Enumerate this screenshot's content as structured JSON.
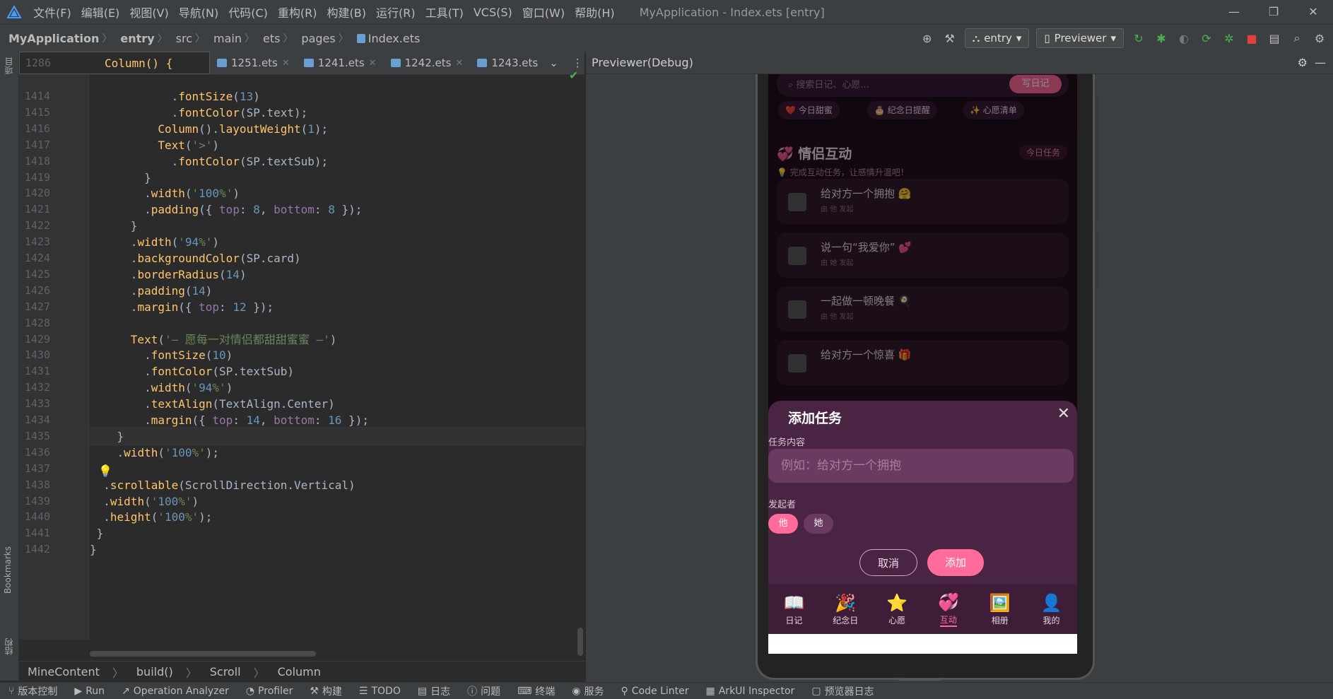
{
  "window": {
    "title": "MyApplication - Index.ets [entry]",
    "menus": [
      "文件(F)",
      "编辑(E)",
      "视图(V)",
      "导航(N)",
      "代码(C)",
      "重构(R)",
      "构建(B)",
      "运行(R)",
      "工具(T)",
      "VCS(S)",
      "窗口(W)",
      "帮助(H)"
    ],
    "controls": [
      "—",
      "❐",
      "✕"
    ]
  },
  "breadcrumb": [
    "MyApplication",
    "entry",
    "src",
    "main",
    "ets",
    "pages",
    "Index.ets"
  ],
  "toolbar": {
    "module": "entry",
    "device": "Previewer"
  },
  "left_strip": {
    "project": "项目",
    "bookmarks": "Bookmarks",
    "structure": "结构"
  },
  "editor": {
    "sticky_line_number": "1286",
    "sticky_code": "Column() {",
    "tabs": [
      "1251.ets",
      "1241.ets",
      "1242.ets",
      "1243.ets"
    ],
    "lines": [
      {
        "n": "1414",
        "code": "            .fontSize(13)"
      },
      {
        "n": "1415",
        "code": "            .fontColor(SP.text);"
      },
      {
        "n": "1416",
        "code": "          Column().layoutWeight(1);"
      },
      {
        "n": "1417",
        "code": "          Text('>')"
      },
      {
        "n": "1418",
        "code": "            .fontColor(SP.textSub);"
      },
      {
        "n": "1419",
        "code": "        }"
      },
      {
        "n": "1420",
        "code": "        .width('100%')"
      },
      {
        "n": "1421",
        "code": "        .padding({ top: 8, bottom: 8 });"
      },
      {
        "n": "1422",
        "code": "      }"
      },
      {
        "n": "1423",
        "code": "      .width('94%')"
      },
      {
        "n": "1424",
        "code": "      .backgroundColor(SP.card)"
      },
      {
        "n": "1425",
        "code": "      .borderRadius(14)"
      },
      {
        "n": "1426",
        "code": "      .padding(14)"
      },
      {
        "n": "1427",
        "code": "      .margin({ top: 12 });"
      },
      {
        "n": "1428",
        "code": ""
      },
      {
        "n": "1429",
        "code": "      Text('— 愿每一对情侣都甜甜蜜蜜 —')"
      },
      {
        "n": "1430",
        "code": "        .fontSize(10)"
      },
      {
        "n": "1431",
        "code": "        .fontColor(SP.textSub)"
      },
      {
        "n": "1432",
        "code": "        .width('94%')"
      },
      {
        "n": "1433",
        "code": "        .textAlign(TextAlign.Center)"
      },
      {
        "n": "1434",
        "code": "        .margin({ top: 14, bottom: 16 });"
      },
      {
        "n": "1435",
        "code": "    }"
      },
      {
        "n": "1436",
        "code": "    .width('100%');"
      },
      {
        "n": "1437",
        "code": "  }"
      },
      {
        "n": "1438",
        "code": "  .scrollable(ScrollDirection.Vertical)"
      },
      {
        "n": "1439",
        "code": "  .width('100%')"
      },
      {
        "n": "1440",
        "code": "  .height('100%');"
      },
      {
        "n": "1441",
        "code": " }"
      },
      {
        "n": "1442",
        "code": "}"
      }
    ],
    "current_line": "1435",
    "breadcrumbs": [
      "MineContent",
      "build()",
      "Scroll",
      "Column"
    ]
  },
  "previewer": {
    "title": "Previewer(Debug)",
    "app": {
      "search_placeholder": "搜索日记、心愿...",
      "write_button": "写日记",
      "chips": [
        "❤️ 今日甜蜜",
        "🎂 纪念日提醒",
        "✨ 心愿清单"
      ],
      "section_title": "💞 情侣互动",
      "section_badge": "今日任务",
      "section_subtitle": "💡 完成互动任务，让感情升温吧！",
      "tasks": [
        {
          "title": "给对方一个拥抱 🤗",
          "by": "由 他 发起"
        },
        {
          "title": "说一句“我爱你” 💕",
          "by": "由 她 发起"
        },
        {
          "title": "一起做一顿晚餐 🍳",
          "by": "由 他 发起"
        },
        {
          "title": "给对方一个惊喜 🎁",
          "by": ""
        }
      ],
      "dialog": {
        "title": "添加任务",
        "content_label": "任务内容",
        "content_placeholder": "例如：给对方一个拥抱",
        "initiator_label": "发起者",
        "initiator_options": [
          "他",
          "她"
        ],
        "selected_initiator": "他",
        "cancel": "取消",
        "add": "添加"
      },
      "nav": [
        {
          "icon": "📖",
          "label": "日记"
        },
        {
          "icon": "🎉",
          "label": "纪念日"
        },
        {
          "icon": "⭐",
          "label": "心愿"
        },
        {
          "icon": "💞",
          "label": "互动"
        },
        {
          "icon": "🖼️",
          "label": "相册"
        },
        {
          "icon": "👤",
          "label": "我的"
        }
      ],
      "active_nav": "互动"
    }
  },
  "bottom_toolbar": [
    "版本控制",
    "Run",
    "Operation Analyzer",
    "Profiler",
    "构建",
    "TODO",
    "日志",
    "问题",
    "终端",
    "服务",
    "Code Linter",
    "ArkUI Inspector",
    "预览器日志"
  ]
}
